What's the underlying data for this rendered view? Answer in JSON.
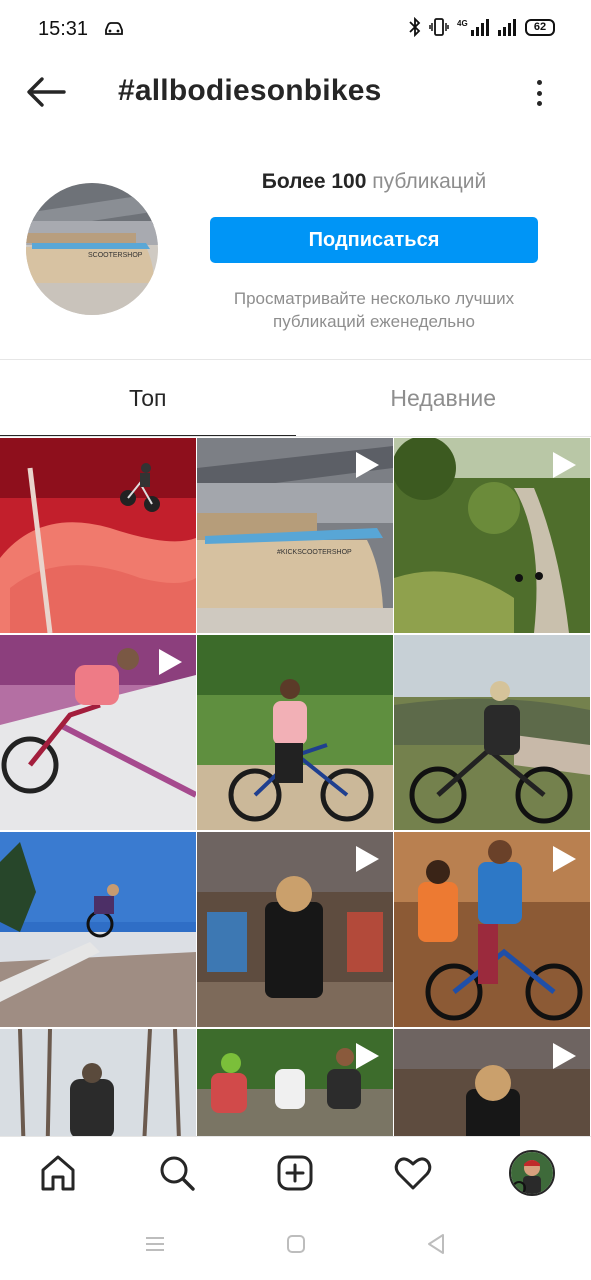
{
  "status_bar": {
    "time": "15:31",
    "network": "4G",
    "battery": "62"
  },
  "header": {
    "title": "#allbodiesonbikes"
  },
  "profile": {
    "posts_count": "Более 100",
    "posts_word": "публикаций",
    "follow_label": "Подписаться",
    "hint": "Просматривайте несколько лучших публикаций еженедельно"
  },
  "tabs": [
    {
      "label": "Топ",
      "active": true
    },
    {
      "label": "Недавние",
      "active": false
    }
  ],
  "grid": {
    "posts": [
      {
        "subject": "bmx-rider-pink-balloon",
        "video": false
      },
      {
        "subject": "skatepark-ramp",
        "video": true
      },
      {
        "subject": "gravel-road-riders",
        "video": true
      },
      {
        "subject": "bmx-rider-pink-ramp",
        "video": true
      },
      {
        "subject": "woman-with-mountain-bike-park",
        "video": false
      },
      {
        "subject": "woman-with-bike-valley",
        "video": false
      },
      {
        "subject": "bmx-jump-street",
        "video": false
      },
      {
        "subject": "bike-shop-mechanic",
        "video": true
      },
      {
        "subject": "couple-on-trainer-bike",
        "video": true
      },
      {
        "subject": "winter-forest-rider",
        "video": false
      },
      {
        "subject": "group-cycling",
        "video": true
      },
      {
        "subject": "bike-shop-mechanic-2",
        "video": true
      }
    ]
  },
  "bottom_nav": {
    "items": [
      "home-icon",
      "search-icon",
      "new-post-icon",
      "activity-heart-icon",
      "profile-avatar"
    ]
  },
  "colors": {
    "accent": "#0095f6",
    "text_primary": "#262626",
    "text_secondary": "#8e8e8e"
  }
}
